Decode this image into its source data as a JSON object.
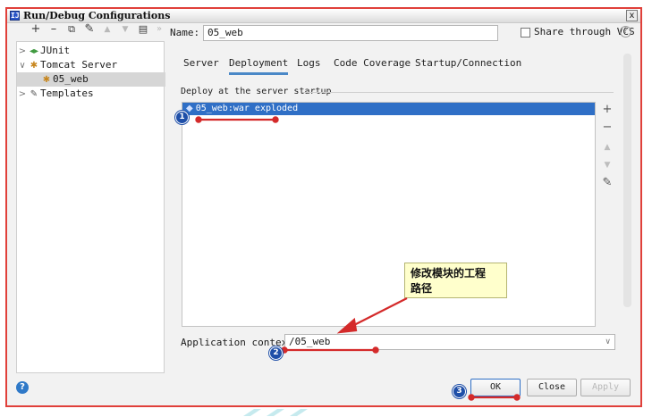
{
  "window": {
    "title": "Run/Debug Configurations",
    "app_icon": "intellij-icon",
    "close_label": "x"
  },
  "toolbar": {
    "add_icon": "+",
    "remove_icon": "–",
    "copy_icon": "⧉",
    "wrench_icon": "✎",
    "up_icon": "▲",
    "down_icon": "▼",
    "folder_icon": "▤",
    "more_icon": "»"
  },
  "tree": {
    "items": [
      {
        "label": "JUnit",
        "icon": "junit-icon",
        "glyph": "◂▸",
        "arrow": ">"
      },
      {
        "label": "Tomcat Server",
        "icon": "tomcat-icon",
        "glyph": "✱",
        "arrow": "∨"
      },
      {
        "label": "05_web",
        "icon": "tomcat-icon",
        "glyph": "✱",
        "arrow": ""
      },
      {
        "label": "Templates",
        "icon": "wrench-icon",
        "glyph": "✎",
        "arrow": ">"
      }
    ]
  },
  "name": {
    "label": "Name:",
    "value": "05_web"
  },
  "share": {
    "label": "Share through VCS",
    "checked": false,
    "help": "?"
  },
  "tabs": [
    "Server",
    "Deployment",
    "Logs",
    "Code Coverage",
    "Startup/Connection"
  ],
  "active_tab": "Deployment",
  "deploy": {
    "section_label": "Deploy at the server startup",
    "items": [
      {
        "label": "05_web:war exploded",
        "selected": true
      }
    ],
    "tools": {
      "add": "+",
      "remove": "−",
      "up": "▲",
      "down": "▼",
      "edit": "✎"
    }
  },
  "app_context": {
    "label": "Application context:",
    "value": "/05_web",
    "caret": "∨"
  },
  "callout": {
    "line1": "修改模块的工程",
    "line2": "路径"
  },
  "buttons": {
    "ok": "OK",
    "close": "Close",
    "apply": "Apply",
    "help": "?"
  },
  "badges": [
    "1",
    "2",
    "3"
  ],
  "colors": {
    "accent": "#2f6fc6",
    "annotation": "#d42a2a",
    "badge": "#1f4fa8",
    "callout_bg": "#ffffcc",
    "frame": "#e0403a"
  }
}
